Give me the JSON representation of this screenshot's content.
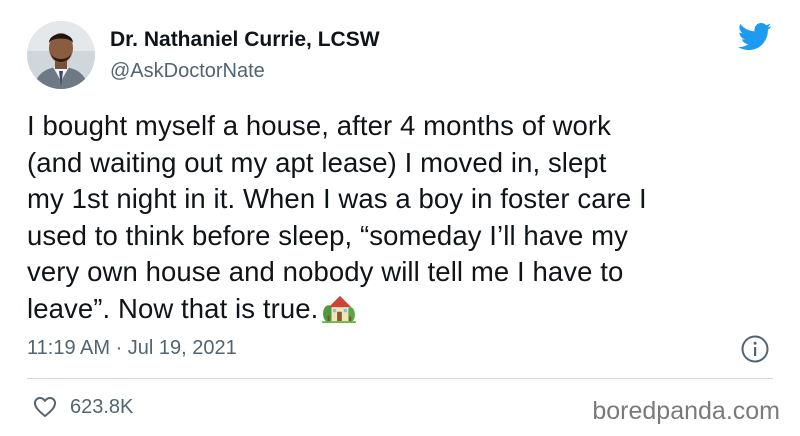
{
  "author": {
    "display_name": "Dr. Nathaniel Currie, LCSW",
    "handle": "@AskDoctorNate"
  },
  "tweet": {
    "text_lines": [
      "I bought myself a house, after 4 months of work",
      "(and waiting out my apt lease) I moved in, slept",
      "my 1st night in it. When I was a boy in foster care I",
      "used to think before sleep, “someday I’ll have my",
      "very own house and nobody will tell me I have to",
      "leave”. Now that is true."
    ],
    "emoji": "house-with-garden",
    "timestamp": "11:19 AM · Jul 19, 2021"
  },
  "engagement": {
    "likes": "623.8K"
  },
  "watermark": "boredpanda.com",
  "colors": {
    "twitter_blue": "#1d9bf0",
    "secondary_text": "#536471",
    "primary_text": "#0f1419"
  },
  "icons": {
    "brand": "twitter-bird-icon",
    "info": "info-icon",
    "like": "heart-icon"
  }
}
